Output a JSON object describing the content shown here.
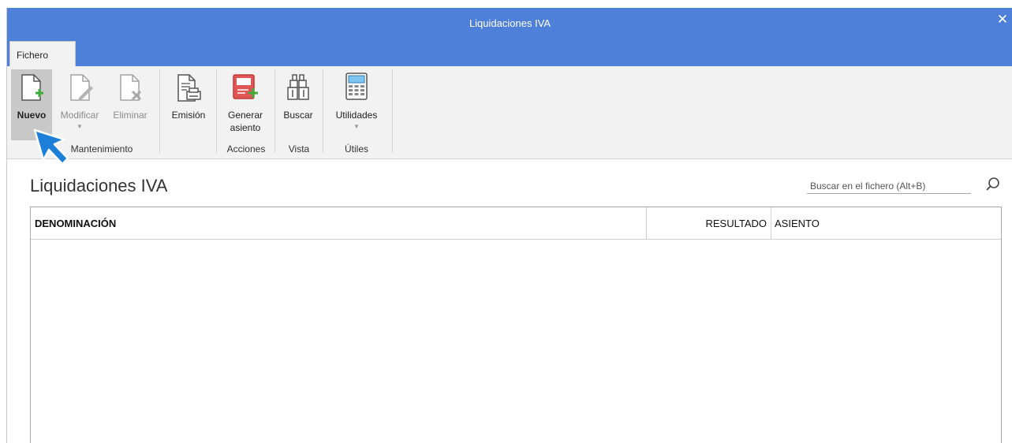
{
  "window": {
    "title": "Liquidaciones IVA",
    "close_glyph": "✕"
  },
  "tabs": [
    {
      "label": "Fichero",
      "selected": true
    }
  ],
  "ribbon": {
    "groups": [
      {
        "label": "Mantenimiento"
      },
      {
        "label": "Acciones"
      },
      {
        "label": "Vista"
      },
      {
        "label": "Útiles"
      }
    ],
    "buttons": {
      "nuevo": {
        "label": "Nuevo",
        "icon": "new-document-icon",
        "state": "active"
      },
      "modificar": {
        "label": "Modificar",
        "icon": "edit-document-icon",
        "state": "disabled",
        "has_dropdown": true
      },
      "eliminar": {
        "label": "Eliminar",
        "icon": "delete-document-icon",
        "state": "disabled"
      },
      "emision": {
        "label": "Emisión",
        "icon": "print-document-icon",
        "state": "enabled"
      },
      "generar": {
        "label_line1": "Generar",
        "label_line2": "asiento",
        "icon": "generate-entry-icon",
        "state": "enabled"
      },
      "buscar": {
        "label": "Buscar",
        "icon": "binoculars-icon",
        "state": "enabled"
      },
      "utilidades": {
        "label": "Utilidades",
        "icon": "calculator-icon",
        "state": "enabled",
        "has_dropdown": true
      }
    }
  },
  "main": {
    "heading": "Liquidaciones IVA",
    "search": {
      "placeholder": "Buscar en el fichero (Alt+B)",
      "value": ""
    },
    "table": {
      "columns": [
        "DENOMINACIÓN",
        "RESULTADO",
        "ASIENTO"
      ],
      "rows": []
    }
  },
  "colors": {
    "titlebar": "#4f80d9",
    "ribbon_bg": "#f2f2f2",
    "accent_green": "#3eab3a",
    "accent_red": "#d83b3b",
    "cursor_blue": "#1e7fd8"
  }
}
